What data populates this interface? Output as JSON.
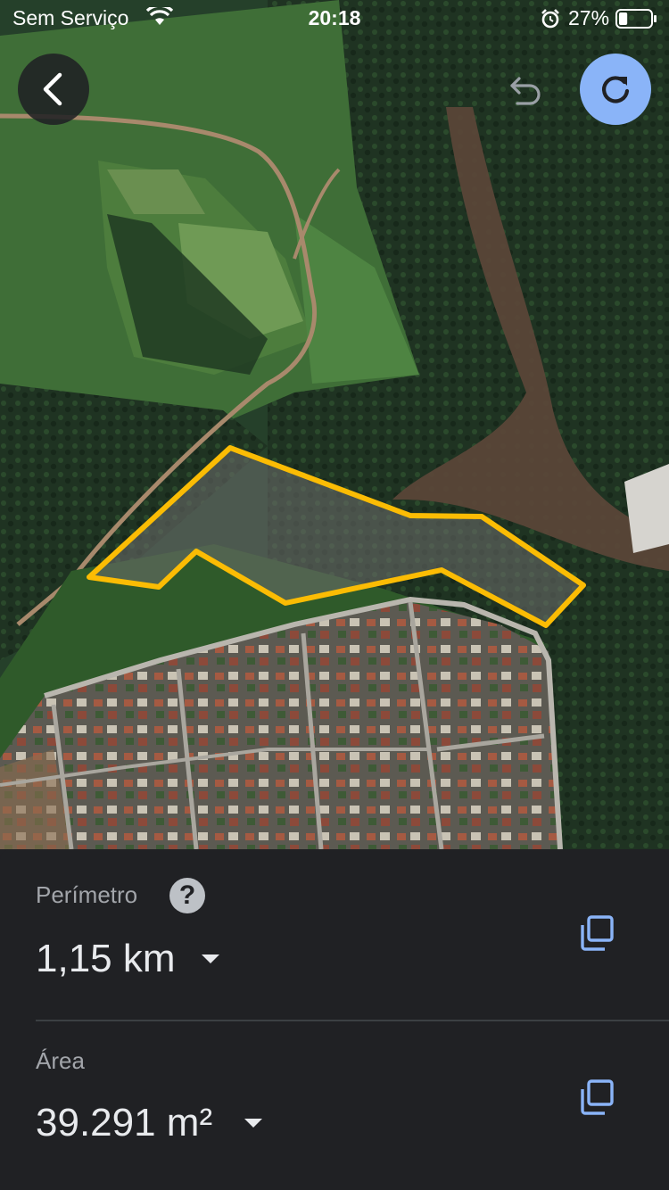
{
  "status_bar": {
    "carrier": "Sem Serviço",
    "time": "20:18",
    "battery_percent": "27%",
    "battery_level": 0.27,
    "icons": [
      "wifi-icon",
      "alarm-icon",
      "battery-icon"
    ]
  },
  "map": {
    "type": "satellite",
    "controls": {
      "back_icon": "chevron-left-icon",
      "undo_icon": "undo-icon",
      "redo_icon": "redo-icon"
    },
    "polygon_color": "#fbbc04"
  },
  "measurements": {
    "perimeter": {
      "label": "Perímetro",
      "value": "1,15 km",
      "help_symbol": "?"
    },
    "area": {
      "label": "Área",
      "value": "39.291 m²"
    }
  },
  "colors": {
    "accent": "#8ab4f8",
    "sheet_bg": "#202124",
    "label": "#a2a5aa",
    "value": "#e8eaed"
  }
}
